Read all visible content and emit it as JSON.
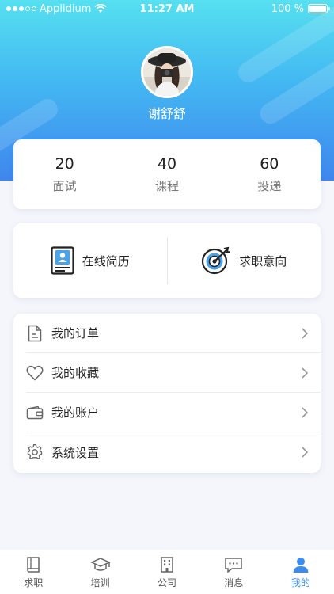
{
  "status_bar": {
    "carrier": "Applidium",
    "time": "11:27 AM",
    "battery": "100 %"
  },
  "profile": {
    "name": "谢舒舒"
  },
  "stats": [
    {
      "value": "20",
      "label": "面试"
    },
    {
      "value": "40",
      "label": "课程"
    },
    {
      "value": "60",
      "label": "投递"
    }
  ],
  "quick_actions": {
    "resume": "在线简历",
    "intention": "求职意向"
  },
  "menu": {
    "orders": "我的订单",
    "favorites": "我的收藏",
    "account": "我的账户",
    "settings": "系统设置"
  },
  "tabs": {
    "jobs": "求职",
    "training": "培训",
    "company": "公司",
    "messages": "消息",
    "mine": "我的",
    "active": "mine"
  },
  "colors": {
    "accent": "#3a8cf0",
    "gradient_top": "#56e0f0",
    "gradient_bottom": "#3f86ee"
  }
}
